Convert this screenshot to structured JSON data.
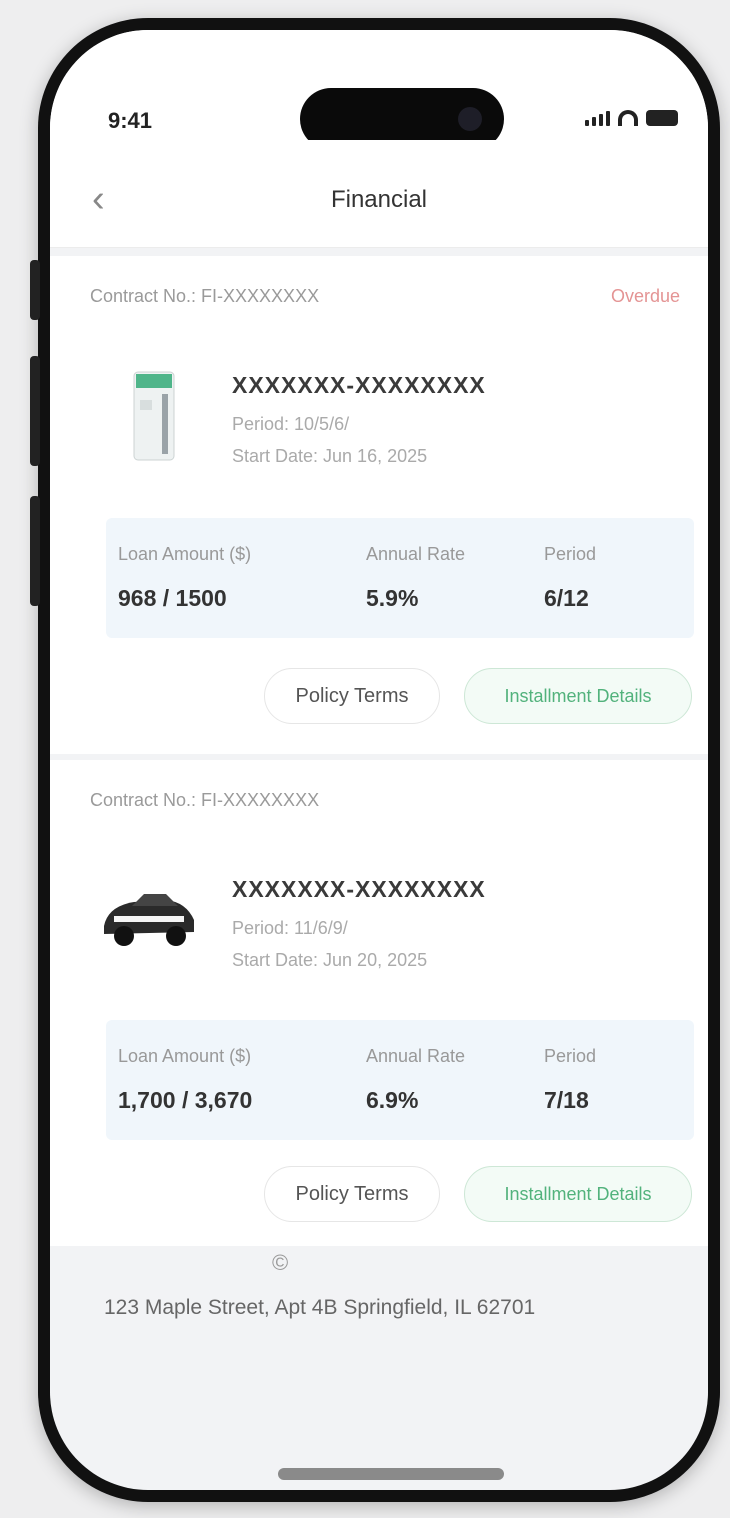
{
  "status_bar": {
    "time": "9:41"
  },
  "header": {
    "title": "Financial",
    "back_glyph": "‹"
  },
  "orders": [
    {
      "order_no": "Contract No.: FI-XXXXXXXX",
      "status": "Overdue",
      "thumbnail_icon": "appliance-icon",
      "product_name": "XXXXXXX-XXXXXXXX",
      "product_sub": "Period: 10/5/6/",
      "product_date": "Start Date: Jun 16, 2025",
      "stats": [
        {
          "label": "Loan Amount ($)",
          "value": "968 / 1500"
        },
        {
          "label": "Annual Rate",
          "value": "5.9%"
        },
        {
          "label": "Period",
          "value": "6/12"
        }
      ],
      "btn_terms": "Policy Terms",
      "btn_contract": "Installment Details"
    },
    {
      "order_no": "Contract No.: FI-XXXXXXXX",
      "status": "",
      "thumbnail_icon": "car-icon",
      "product_name": "XXXXXXX-XXXXXXXX",
      "product_sub": "Period: 11/6/9/",
      "product_date": "Start Date: Jun 20, 2025",
      "stats": [
        {
          "label": "Loan Amount ($)",
          "value": "1,700 / 3,670"
        },
        {
          "label": "Annual Rate",
          "value": "6.9%"
        },
        {
          "label": "Period",
          "value": "7/18"
        }
      ],
      "btn_terms": "Policy Terms",
      "btn_contract": "Installment Details"
    }
  ],
  "footer": {
    "mark": "©",
    "address": "123 Maple Street, Apt 4B Springfield, IL 62701"
  },
  "colors": {
    "overdue": "#e49494",
    "contract_accent": "#52b27c",
    "stats_bg": "#f0f6fb"
  }
}
